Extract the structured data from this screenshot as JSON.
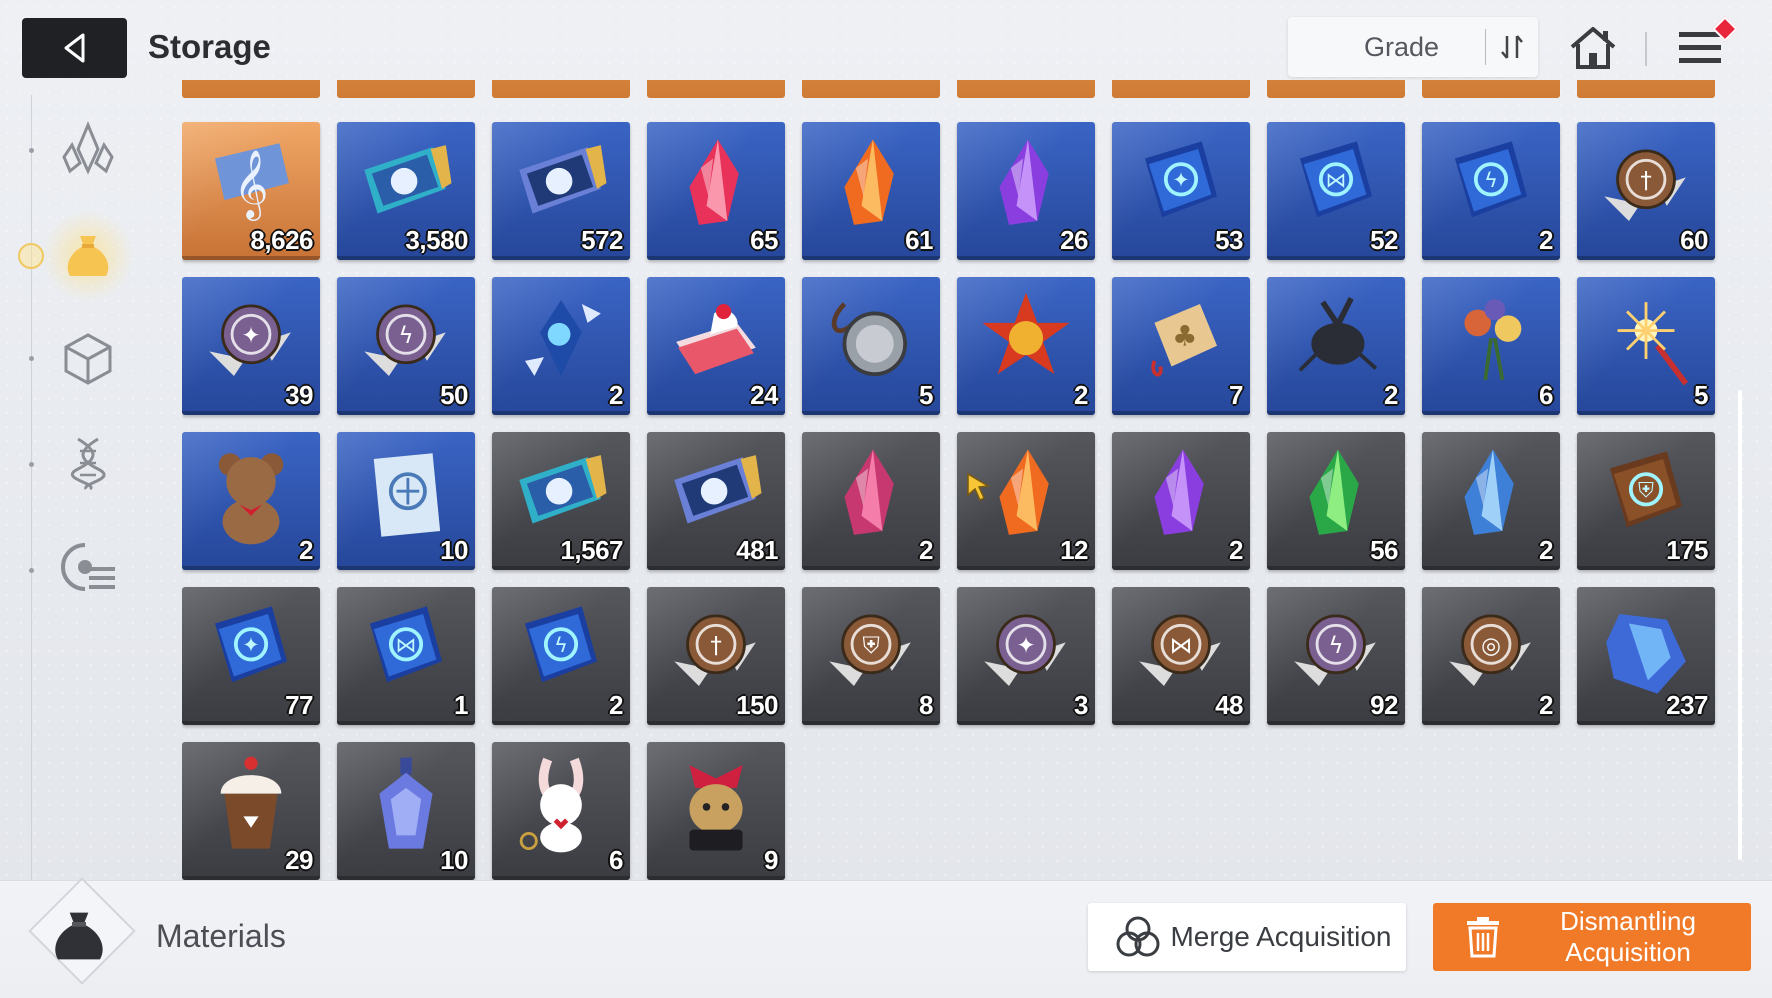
{
  "header": {
    "title": "Storage",
    "sort_label": "Grade",
    "icons": {
      "back": "back-arrow-icon",
      "sort_order": "sort-order-icon",
      "home": "home-icon",
      "menu": "hamburger-menu-icon"
    }
  },
  "sidebar": {
    "tabs": [
      {
        "icon": "crystal-icon",
        "active": false
      },
      {
        "icon": "pouch-icon",
        "active": true
      },
      {
        "icon": "cube-icon",
        "active": false
      },
      {
        "icon": "dna-icon",
        "active": false
      },
      {
        "icon": "chip-list-icon",
        "active": false
      }
    ]
  },
  "items": [
    {
      "quantity": "8,626",
      "grade": "orange",
      "icon": "music-score-icon"
    },
    {
      "quantity": "3,580",
      "grade": "blue",
      "icon": "id-card-icon"
    },
    {
      "quantity": "572",
      "grade": "blue",
      "icon": "star-ticket-icon"
    },
    {
      "quantity": "65",
      "grade": "blue",
      "icon": "red-crystal-icon"
    },
    {
      "quantity": "61",
      "grade": "blue",
      "icon": "orange-crystal-icon"
    },
    {
      "quantity": "26",
      "grade": "blue",
      "icon": "purple-crystal-icon"
    },
    {
      "quantity": "53",
      "grade": "blue",
      "icon": "shuriken-book-icon"
    },
    {
      "quantity": "52",
      "grade": "blue",
      "icon": "butterfly-book-icon"
    },
    {
      "quantity": "2",
      "grade": "blue",
      "icon": "lightning-book-icon"
    },
    {
      "quantity": "60",
      "grade": "blue",
      "icon": "sword-medal-icon"
    },
    {
      "quantity": "39",
      "grade": "blue",
      "icon": "shuriken-medal-icon"
    },
    {
      "quantity": "50",
      "grade": "blue",
      "icon": "lightning-medal-icon"
    },
    {
      "quantity": "2",
      "grade": "blue",
      "icon": "ice-shard-icon"
    },
    {
      "quantity": "24",
      "grade": "blue",
      "icon": "strawberry-cake-icon"
    },
    {
      "quantity": "5",
      "grade": "blue",
      "icon": "pocket-watch-icon"
    },
    {
      "quantity": "2",
      "grade": "blue",
      "icon": "star-badge-icon"
    },
    {
      "quantity": "7",
      "grade": "blue",
      "icon": "clover-charm-icon"
    },
    {
      "quantity": "2",
      "grade": "blue",
      "icon": "beetle-icon"
    },
    {
      "quantity": "6",
      "grade": "blue",
      "icon": "flower-bouquet-icon"
    },
    {
      "quantity": "5",
      "grade": "blue",
      "icon": "sparkler-icon"
    },
    {
      "quantity": "2",
      "grade": "blue",
      "icon": "teddy-bear-icon"
    },
    {
      "quantity": "10",
      "grade": "blue",
      "icon": "emblem-book-icon"
    },
    {
      "quantity": "1,567",
      "grade": "gray",
      "icon": "id-card-icon"
    },
    {
      "quantity": "481",
      "grade": "gray",
      "icon": "star-ticket-icon"
    },
    {
      "quantity": "2",
      "grade": "gray",
      "icon": "pink-crystal-icon"
    },
    {
      "quantity": "12",
      "grade": "gray",
      "icon": "orange-crystal-icon"
    },
    {
      "quantity": "2",
      "grade": "gray",
      "icon": "purple-crystal-icon"
    },
    {
      "quantity": "56",
      "grade": "gray",
      "icon": "green-crystal-icon"
    },
    {
      "quantity": "2",
      "grade": "gray",
      "icon": "blue-crystal-icon"
    },
    {
      "quantity": "175",
      "grade": "gray",
      "icon": "shield-book-icon"
    },
    {
      "quantity": "77",
      "grade": "gray",
      "icon": "shuriken-book-icon"
    },
    {
      "quantity": "1",
      "grade": "gray",
      "icon": "butterfly-book-icon"
    },
    {
      "quantity": "2",
      "grade": "gray",
      "icon": "lightning-book-icon"
    },
    {
      "quantity": "150",
      "grade": "gray",
      "icon": "sword-medal-icon"
    },
    {
      "quantity": "8",
      "grade": "gray",
      "icon": "shield-medal-icon"
    },
    {
      "quantity": "3",
      "grade": "gray",
      "icon": "shuriken-medal-icon"
    },
    {
      "quantity": "48",
      "grade": "gray",
      "icon": "butterfly-medal-icon"
    },
    {
      "quantity": "92",
      "grade": "gray",
      "icon": "lightning-medal-icon"
    },
    {
      "quantity": "2",
      "grade": "gray",
      "icon": "target-medal-icon"
    },
    {
      "quantity": "237",
      "grade": "gray",
      "icon": "blue-ore-icon"
    },
    {
      "quantity": "29",
      "grade": "gray",
      "icon": "frappe-icon"
    },
    {
      "quantity": "10",
      "grade": "gray",
      "icon": "perfume-bottle-icon"
    },
    {
      "quantity": "6",
      "grade": "gray",
      "icon": "bunny-keychain-icon"
    },
    {
      "quantity": "9",
      "grade": "gray",
      "icon": "gift-doll-icon"
    }
  ],
  "footer": {
    "category_label": "Materials",
    "category_icon": "pouch-icon",
    "merge_label": "Merge Acquisition",
    "merge_icon": "merge-circles-icon",
    "dismantle_label": "Dismantling Acquisition",
    "dismantle_icon": "trash-icon"
  },
  "colors": {
    "accent": "#f07a28",
    "grade_orange": "#e09050",
    "grade_blue": "#3157b0",
    "grade_gray": "#48494e"
  }
}
